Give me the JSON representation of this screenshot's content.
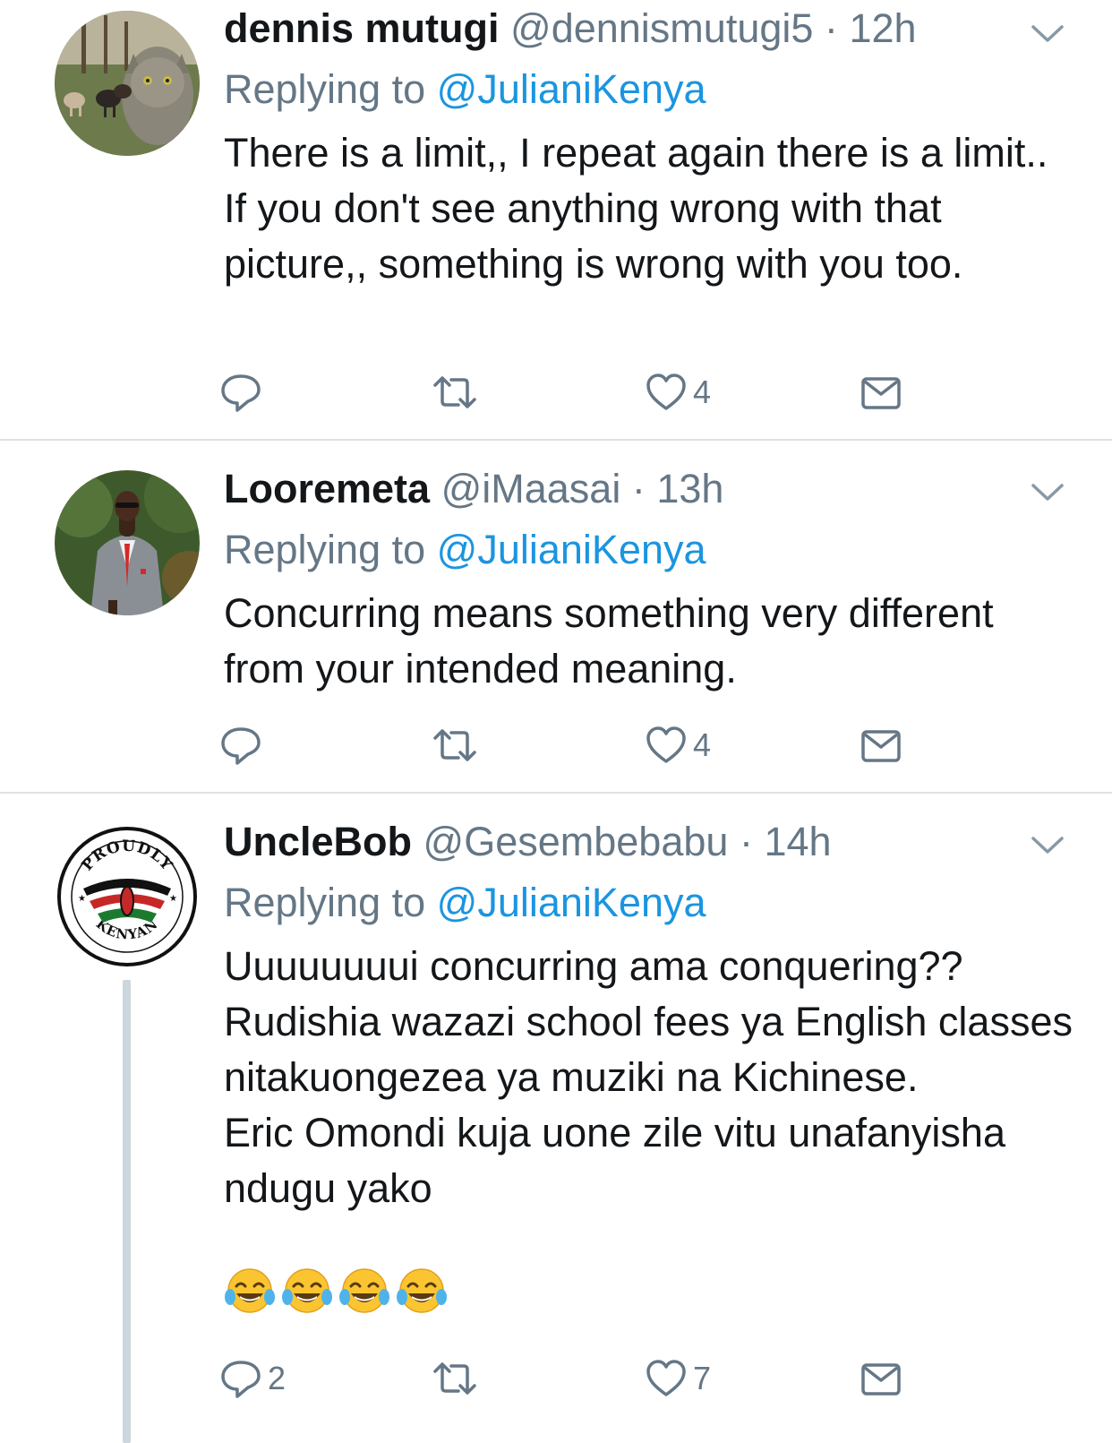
{
  "colors": {
    "link": "#1b95e0",
    "secondary_text": "#657786",
    "primary_text": "#14171a",
    "divider": "#dfe3e7",
    "thread_line": "#ccd6dd"
  },
  "tweets": [
    {
      "name": "dennis mutugi",
      "handle": "@dennismutugi5",
      "dot": "·",
      "time": "12h",
      "replying_prefix": "Replying to",
      "replying_to": "@JulianiKenya",
      "body": [
        "There is a limit,, I repeat again there is a limit.. If you don't see anything wrong with that picture,, something is wrong with you too."
      ],
      "replies": "",
      "retweets": "",
      "likes": "4",
      "avatar_icon": "cat-and-dogs-photo"
    },
    {
      "name": "Looremeta",
      "handle": "@iMaasai",
      "dot": "·",
      "time": "13h",
      "replying_prefix": "Replying to",
      "replying_to": "@JulianiKenya",
      "body": [
        "Concurring means something very different from your intended meaning."
      ],
      "replies": "",
      "retweets": "",
      "likes": "4",
      "avatar_icon": "man-in-suit-photo"
    },
    {
      "name": "UncleBob",
      "handle": "@Gesembebabu",
      "dot": "·",
      "time": "14h",
      "replying_prefix": "Replying to",
      "replying_to": "@JulianiKenya",
      "body": [
        "Uuuuuuuui concurring ama conquering??",
        "Rudishia wazazi school fees ya English classes nitakuongezea ya muziki na Kichinese.",
        "Eric Omondi kuja uone zile vitu unafanyisha ndugu yako"
      ],
      "emoji": [
        "😂",
        "😂",
        "😂",
        "😂"
      ],
      "replies": "2",
      "retweets": "",
      "likes": "7",
      "avatar_icon": "proudly-kenyan-badge",
      "badge_text_top": "PROUDLY",
      "badge_text_bottom": "KENYAN"
    }
  ]
}
